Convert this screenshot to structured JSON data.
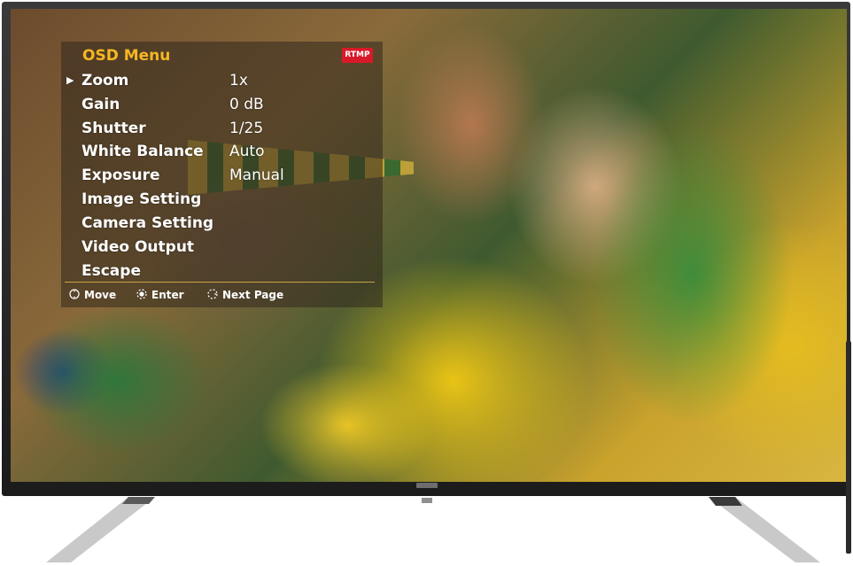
{
  "osd": {
    "title": "OSD Menu",
    "badge": "RTMP",
    "selected_index": 0,
    "items": [
      {
        "label": "Zoom",
        "value": "1x",
        "selected": true
      },
      {
        "label": "Gain",
        "value": "0 dB",
        "selected": false
      },
      {
        "label": "Shutter",
        "value": "1/25",
        "selected": false
      },
      {
        "label": "White Balance",
        "value": "Auto",
        "selected": false
      },
      {
        "label": "Exposure",
        "value": "Manual",
        "selected": false
      },
      {
        "label": "Image Setting",
        "value": "",
        "selected": false
      },
      {
        "label": "Camera Setting",
        "value": "",
        "selected": false
      },
      {
        "label": "Video Output",
        "value": "",
        "selected": false
      },
      {
        "label": "Escape",
        "value": "",
        "selected": false
      }
    ],
    "cursor_glyph": "▶",
    "hints": [
      {
        "icon": "dpad-icon",
        "label": "Move"
      },
      {
        "icon": "enter-dot-icon",
        "label": "Enter"
      },
      {
        "icon": "dpad-right-icon",
        "label": "Next Page"
      }
    ]
  },
  "colors": {
    "title": "#f5b722",
    "badge_bg": "#d8192a",
    "text": "#ffffff",
    "divider": "#c9a544",
    "bezel": "#1b1b1b"
  }
}
